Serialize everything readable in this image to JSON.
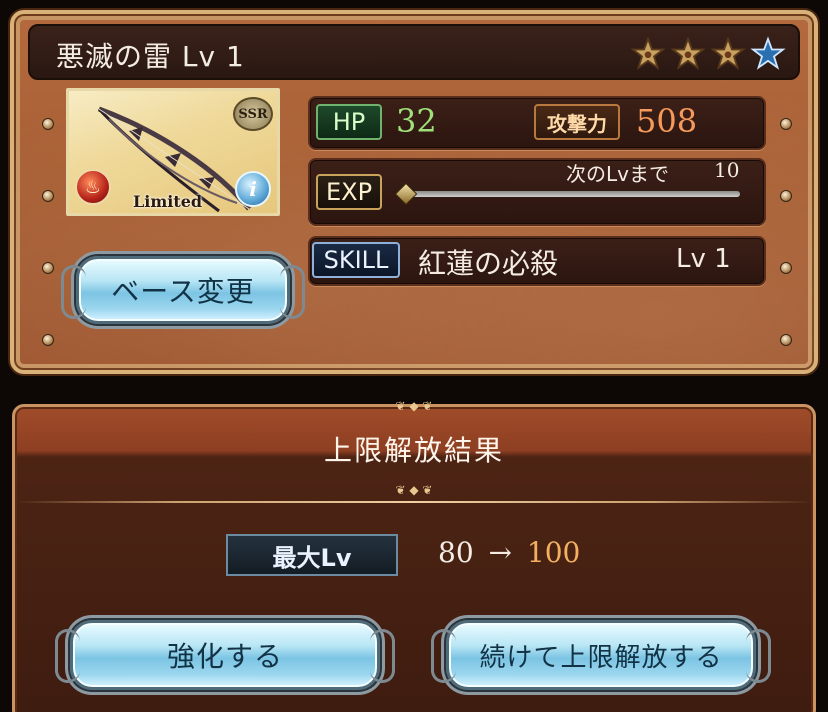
{
  "weapon": {
    "name_label": "悪滅の雷 Lv 1",
    "stars_total": 4,
    "stars_filled": 3,
    "star_colors": {
      "filled": "#c8a060",
      "empty": "#2a6fb0"
    },
    "thumbnail": {
      "rarity": "SSR",
      "tag": "Limited",
      "element_icon": "fire-icon",
      "info_icon": "info-icon"
    }
  },
  "change_base_button": "ベース変更",
  "stats": {
    "hp_label": "HP",
    "hp_value": "32",
    "attack_label": "攻撃力",
    "attack_value": "508",
    "exp_label": "EXP",
    "exp_next_label": "次のLvまで",
    "exp_next_value": "10",
    "exp_progress": 0.0,
    "skill_label": "SKILL",
    "skill_name": "紅蓮の必殺",
    "skill_level": "Lv 1"
  },
  "result": {
    "title": "上限解放結果",
    "max_lv_label": "最大Lv",
    "max_lv_from": "80",
    "arrow": "→",
    "max_lv_to": "100"
  },
  "actions": {
    "enhance_button": "強化する",
    "continue_uncap_button": "続けて上限解放する"
  },
  "colors": {
    "hp_value": "#9fe07a",
    "attack_value": "#f59a5a",
    "new_level": "#f3b060"
  }
}
